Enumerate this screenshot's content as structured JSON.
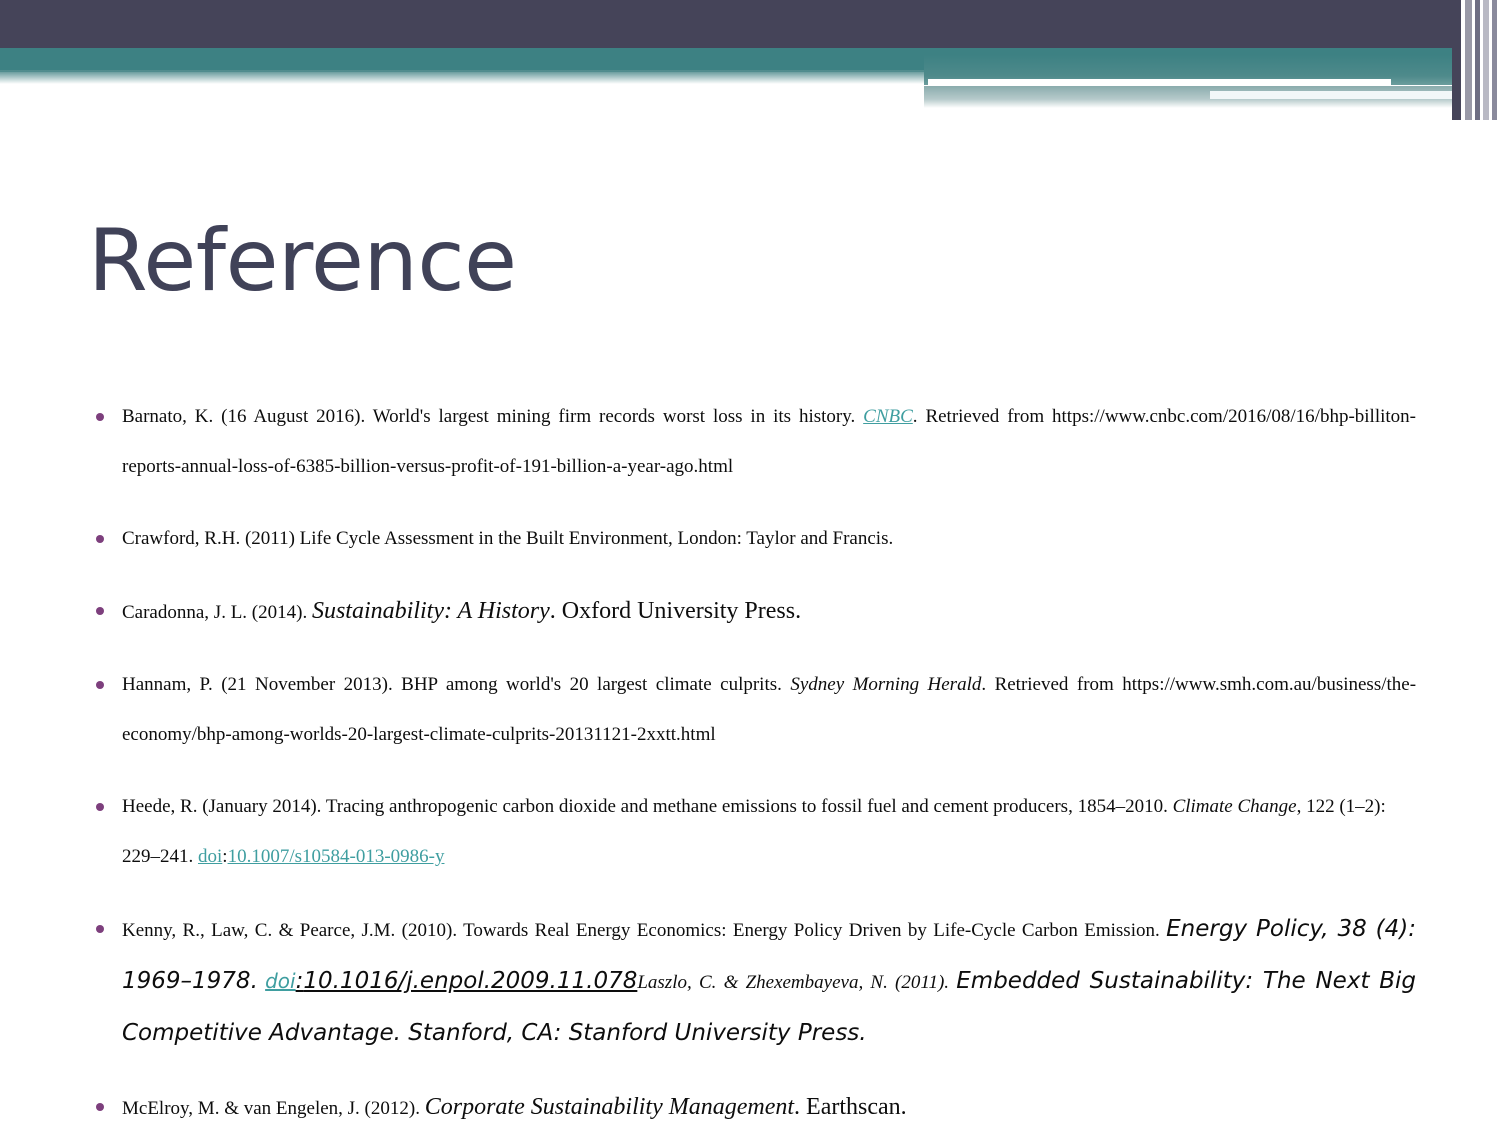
{
  "slide": {
    "title": "Reference",
    "accent_colors": {
      "banner_dark": "#454459",
      "banner_teal": "#3d8183",
      "title_text": "#404258",
      "bullet": "#7d3f7d",
      "hyperlink": "#3f9ea0"
    }
  },
  "references": [
    {
      "id": "ref-barnato",
      "author_date": "Barnato, K. (16 August 2016).",
      "article_title": "World's largest mining firm records worst loss in its history.",
      "source": "CNBC",
      "source_is_link": true,
      "retrieved_label": "Retrieved from",
      "url": "https://www.cnbc.com/2016/08/16/bhp-billiton-reports-annual-loss-of-6385-billion-versus-profit-of-191-billion-a-year-ago.html"
    },
    {
      "id": "ref-crawford",
      "text": "Crawford, R.H. (2011) Life Cycle Assessment in the Built Environment, London: Taylor and Francis."
    },
    {
      "id": "ref-caradonna",
      "author_date": "Caradonna, J. L. (2014).",
      "book_title": "Sustainability: A History",
      "publisher": ". Oxford University Press."
    },
    {
      "id": "ref-hannam",
      "author_date": "Hannam, P. (21 November 2013).",
      "article_title": "BHP among world's 20 largest climate culprits.",
      "source": "Sydney Morning Herald",
      "source_is_link": false,
      "retrieved_label": "Retrieved from",
      "url": "https://www.smh.com.au/business/the-economy/bhp-among-worlds-20-largest-climate-culprits-20131121-2xxtt.html"
    },
    {
      "id": "ref-heede",
      "author_date": "Heede, R. (January 2014).",
      "article_title": "Tracing anthropogenic carbon dioxide and methane emissions to fossil fuel and cement producers, 1854–2010.",
      "journal": "Climate Change",
      "volume_pages": ", 122 (1–2): 229–241.",
      "doi_label": "doi",
      "doi_separator": ":",
      "doi_value": "10.1007/s10584-013-0986-y"
    },
    {
      "id": "ref-kenny",
      "author_date": "Kenny, R., Law, C. & Pearce, J.M. (2010).",
      "article_title": "Towards Real Energy Economics: Energy Policy Driven by Life-Cycle Carbon Emission.",
      "journal": "Energy Policy, 38 (4): 1969–1978.",
      "doi_label": "doi",
      "doi_separator": ":",
      "doi_value": "10.1016/j.enpol.2009.11.078",
      "second_author_date": "Laszlo, C. & Zhexembayeva, N. (2011).",
      "second_book_title": "Embedded Sustainability: The Next Big Competitive Advantage",
      "second_publisher": ". Stanford, CA: Stanford University Press."
    },
    {
      "id": "ref-mcelroy",
      "author_date": "McElroy, M. & van Engelen, J. (2012).",
      "book_title": "Corporate Sustainability Management",
      "publisher": ". Earthscan."
    }
  ]
}
